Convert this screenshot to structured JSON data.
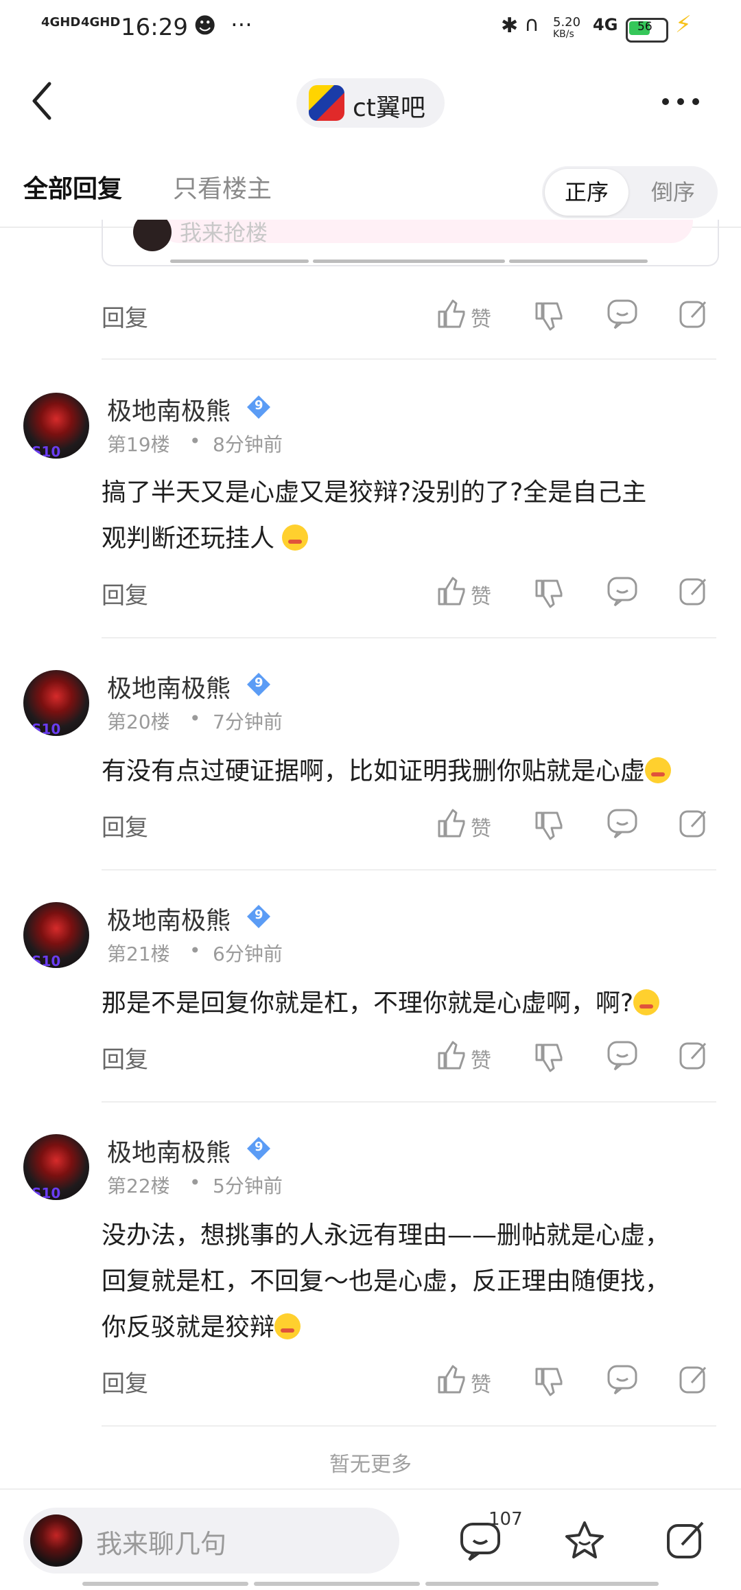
{
  "status_bar": {
    "signal_1": "4GHD",
    "signal_2": "4GHD",
    "time": "16:29",
    "speed": "5.20",
    "speed_unit": "KB/s",
    "network": "4G",
    "battery": "56"
  },
  "header": {
    "forum_name": "ct翼吧"
  },
  "tabs": {
    "all_replies": "全部回复",
    "op_only": "只看楼主",
    "sort_asc": "正序",
    "sort_desc": "倒序"
  },
  "partial_card": {
    "placeholder": "我来抢楼"
  },
  "actions": {
    "reply": "回复",
    "like": "赞"
  },
  "posts": [
    {
      "username": "极地南极熊",
      "level": "9",
      "floor": "第19楼",
      "time": "8分钟前",
      "lines": [
        "搞了半天又是心虚又是狡辩?没别的了?全是自己主",
        "观判断还玩挂人"
      ]
    },
    {
      "username": "极地南极熊",
      "level": "9",
      "floor": "第20楼",
      "time": "7分钟前",
      "lines": [
        "有没有点过硬证据啊，比如证明我删你贴就是心虚"
      ]
    },
    {
      "username": "极地南极熊",
      "level": "9",
      "floor": "第21楼",
      "time": "6分钟前",
      "lines": [
        "那是不是回复你就是杠，不理你就是心虚啊，啊?"
      ]
    },
    {
      "username": "极地南极熊",
      "level": "9",
      "floor": "第22楼",
      "time": "5分钟前",
      "lines": [
        "没办法，想挑事的人永远有理由——删帖就是心虚，",
        "回复就是杠，不回复～也是心虚，反正理由随便找，",
        "你反驳就是狡辩"
      ]
    }
  ],
  "footer": {
    "no_more": "暂无更多",
    "input_placeholder": "我来聊几句",
    "comment_count": "107"
  },
  "colors": {
    "level_badge": "#5b9cf5",
    "battery": "#35c759",
    "charging": "#f7c21b"
  }
}
